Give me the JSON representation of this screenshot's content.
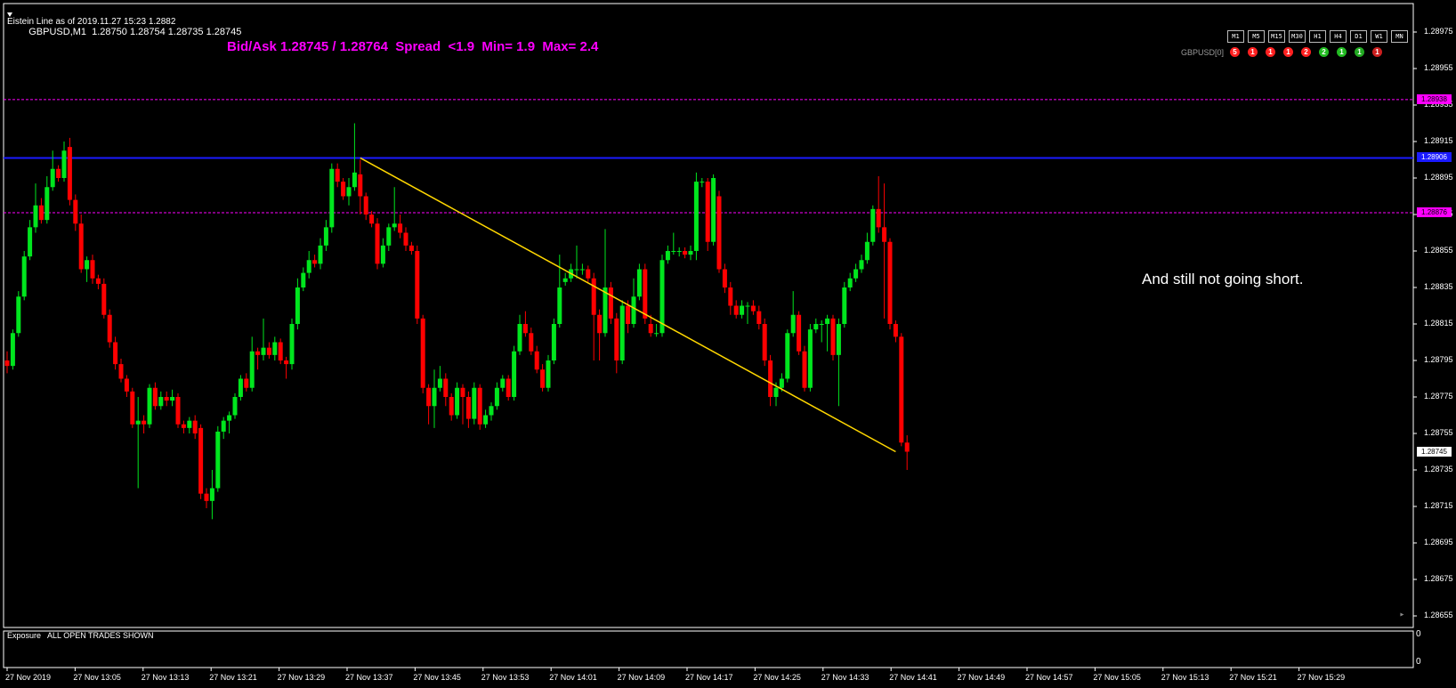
{
  "header": {
    "symbol_line": "GBPUSD,M1  1.28750 1.28754 1.28735 1.28745",
    "indicator_line": "Eistein Line as of 2019.11.27 15:23 1.2882",
    "spread_text": "Bid/Ask 1.28745 / 1.28764  Spread  <1.9  Min= 1.9  Max= 2.4"
  },
  "annotation": "And still not going short.",
  "timeframes": [
    "M1",
    "M5",
    "M15",
    "M30",
    "H1",
    "H4",
    "D1",
    "W1",
    "MN"
  ],
  "strength": {
    "label": "GBPUSD[0]",
    "dots": [
      {
        "value": "5",
        "color": "#ff2020"
      },
      {
        "value": "1",
        "color": "#ff2020"
      },
      {
        "value": "1",
        "color": "#ff2020"
      },
      {
        "value": "1",
        "color": "#ff2020"
      },
      {
        "value": "2",
        "color": "#ff2020"
      },
      {
        "value": "2",
        "color": "#22bb22"
      },
      {
        "value": "1",
        "color": "#22bb22"
      },
      {
        "value": "1",
        "color": "#22aa22"
      },
      {
        "value": "1",
        "color": "#cc1f1f"
      }
    ]
  },
  "subwindow": {
    "label": "Exposure   ALL OPEN TRADES SHOWN",
    "axis_top": "0",
    "axis_bottom": "0"
  },
  "colors": {
    "bull": "#00e61e",
    "bear": "#ff0000",
    "blue_line": "#1a1aff",
    "magenta": "#ff00ff",
    "trendline": "#ffd700"
  },
  "chart_data": {
    "type": "candlestick",
    "symbol": "GBPUSD",
    "timeframe": "M1",
    "y_ticks": [
      "1.28975",
      "1.28955",
      "1.28935",
      "1.28915",
      "1.28895",
      "1.28875",
      "1.28855",
      "1.28835",
      "1.28815",
      "1.28795",
      "1.28775",
      "1.28755",
      "1.28735",
      "1.28715",
      "1.28695",
      "1.28675",
      "1.28655"
    ],
    "ylim": [
      1.28649,
      1.28983
    ],
    "x_ticks": [
      "27 Nov 2019",
      "27 Nov 13:05",
      "27 Nov 13:13",
      "27 Nov 13:21",
      "27 Nov 13:29",
      "27 Nov 13:37",
      "27 Nov 13:45",
      "27 Nov 13:53",
      "27 Nov 14:01",
      "27 Nov 14:09",
      "27 Nov 14:17",
      "27 Nov 14:25",
      "27 Nov 14:33",
      "27 Nov 14:41",
      "27 Nov 14:49",
      "27 Nov 14:57",
      "27 Nov 15:05",
      "27 Nov 15:13",
      "27 Nov 15:21",
      "27 Nov 15:29"
    ],
    "horizontal_lines": [
      {
        "price": 1.28938,
        "label": "1.28938",
        "color": "#ff00ff",
        "style": "dashed"
      },
      {
        "price": 1.28906,
        "label": "1.28906",
        "color": "#1a1aff",
        "style": "solid"
      },
      {
        "price": 1.28876,
        "label": "1.28876",
        "color": "#ff00ff",
        "style": "dashed"
      }
    ],
    "current_price": {
      "price": 1.28745,
      "label": "1.28745"
    },
    "trendline": {
      "from": {
        "bar": 62,
        "price": 1.28906
      },
      "to": {
        "bar": 156,
        "price": 1.28745
      },
      "color": "#ffd700"
    },
    "candles": [
      [
        1.28795,
        1.28792,
        1.288,
        1.28788
      ],
      [
        1.28792,
        1.2881,
        1.28812,
        1.2879
      ],
      [
        1.2881,
        1.2883,
        1.28833,
        1.28808
      ],
      [
        1.2883,
        1.28852,
        1.28855,
        1.28828
      ],
      [
        1.28852,
        1.28868,
        1.28872,
        1.2885
      ],
      [
        1.28868,
        1.2888,
        1.28892,
        1.28865
      ],
      [
        1.2888,
        1.28872,
        1.28884,
        1.2887
      ],
      [
        1.28872,
        1.2889,
        1.28896,
        1.2887
      ],
      [
        1.2889,
        1.289,
        1.2891,
        1.28888
      ],
      [
        1.289,
        1.28895,
        1.28902,
        1.28893
      ],
      [
        1.28895,
        1.2891,
        1.28915,
        1.28893
      ],
      [
        1.28912,
        1.28883,
        1.28917,
        1.2888
      ],
      [
        1.28883,
        1.2887,
        1.28886,
        1.28866
      ],
      [
        1.2887,
        1.28845,
        1.28875,
        1.28843
      ],
      [
        1.28845,
        1.2885,
        1.28852,
        1.28838
      ],
      [
        1.2885,
        1.2884,
        1.28853,
        1.28837
      ],
      [
        1.2884,
        1.28837,
        1.28842,
        1.28834
      ],
      [
        1.28837,
        1.2882,
        1.2884,
        1.28818
      ],
      [
        1.2882,
        1.28805,
        1.28823,
        1.28802
      ],
      [
        1.28805,
        1.28793,
        1.28808,
        1.2879
      ],
      [
        1.28793,
        1.28785,
        1.28796,
        1.28783
      ],
      [
        1.28785,
        1.28778,
        1.28787,
        1.28775
      ],
      [
        1.28778,
        1.2876,
        1.2878,
        1.28758
      ],
      [
        1.2876,
        1.28762,
        1.28775,
        1.28725
      ],
      [
        1.28762,
        1.2876,
        1.28765,
        1.28755
      ],
      [
        1.2876,
        1.2878,
        1.28782,
        1.28758
      ],
      [
        1.2878,
        1.2877,
        1.28783,
        1.28768
      ],
      [
        1.2877,
        1.28775,
        1.28778,
        1.28768
      ],
      [
        1.28775,
        1.28773,
        1.28778,
        1.2877
      ],
      [
        1.28773,
        1.28775,
        1.28779,
        1.2877
      ],
      [
        1.28775,
        1.2876,
        1.28777,
        1.28758
      ],
      [
        1.2876,
        1.28758,
        1.28762,
        1.28755
      ],
      [
        1.28758,
        1.28762,
        1.28764,
        1.28755
      ],
      [
        1.28762,
        1.28755,
        1.28765,
        1.28752
      ],
      [
        1.28758,
        1.28722,
        1.2876,
        1.28719
      ],
      [
        1.28722,
        1.28718,
        1.28725,
        1.28714
      ],
      [
        1.28718,
        1.28725,
        1.28735,
        1.28708
      ],
      [
        1.28725,
        1.28756,
        1.28759,
        1.28723
      ],
      [
        1.28756,
        1.28762,
        1.28764,
        1.28752
      ],
      [
        1.28762,
        1.28765,
        1.28767,
        1.28755
      ],
      [
        1.28765,
        1.28775,
        1.28777,
        1.28763
      ],
      [
        1.28775,
        1.28785,
        1.28787,
        1.28773
      ],
      [
        1.28785,
        1.2878,
        1.28788,
        1.28778
      ],
      [
        1.2878,
        1.288,
        1.28808,
        1.28778
      ],
      [
        1.288,
        1.28798,
        1.28802,
        1.2879
      ],
      [
        1.28798,
        1.28802,
        1.28818,
        1.28795
      ],
      [
        1.28802,
        1.28798,
        1.28805,
        1.28796
      ],
      [
        1.28798,
        1.28805,
        1.28808,
        1.28795
      ],
      [
        1.28805,
        1.28795,
        1.28807,
        1.28793
      ],
      [
        1.28795,
        1.28793,
        1.28797,
        1.28785
      ],
      [
        1.28793,
        1.28815,
        1.28818,
        1.2879
      ],
      [
        1.28815,
        1.28835,
        1.2884,
        1.28812
      ],
      [
        1.28835,
        1.28843,
        1.28846,
        1.28833
      ],
      [
        1.28843,
        1.2885,
        1.28855,
        1.2884
      ],
      [
        1.2885,
        1.28848,
        1.28853,
        1.28846
      ],
      [
        1.28848,
        1.28858,
        1.28862,
        1.28845
      ],
      [
        1.28858,
        1.28868,
        1.28872,
        1.28855
      ],
      [
        1.28868,
        1.289,
        1.28903,
        1.28865
      ],
      [
        1.289,
        1.28893,
        1.28903,
        1.2889
      ],
      [
        1.28893,
        1.28885,
        1.28895,
        1.28883
      ],
      [
        1.28885,
        1.2889,
        1.28895,
        1.2888
      ],
      [
        1.2889,
        1.28898,
        1.28925,
        1.28888
      ],
      [
        1.28897,
        1.28885,
        1.28905,
        1.28875
      ],
      [
        1.28885,
        1.28875,
        1.28887,
        1.28872
      ],
      [
        1.28875,
        1.2887,
        1.28877,
        1.28868
      ],
      [
        1.2887,
        1.28848,
        1.28873,
        1.28845
      ],
      [
        1.28848,
        1.28858,
        1.28862,
        1.28846
      ],
      [
        1.28858,
        1.28868,
        1.2887,
        1.28855
      ],
      [
        1.28868,
        1.2887,
        1.2889,
        1.28866
      ],
      [
        1.2887,
        1.28865,
        1.28875,
        1.28862
      ],
      [
        1.28865,
        1.28858,
        1.28868,
        1.28855
      ],
      [
        1.28858,
        1.28855,
        1.2886,
        1.28853
      ],
      [
        1.28855,
        1.28818,
        1.28858,
        1.28815
      ],
      [
        1.28818,
        1.2878,
        1.2882,
        1.28777
      ],
      [
        1.2878,
        1.2877,
        1.28782,
        1.2876
      ],
      [
        1.2877,
        1.2878,
        1.2879,
        1.28758
      ],
      [
        1.2878,
        1.28785,
        1.28792,
        1.28778
      ],
      [
        1.28785,
        1.28775,
        1.28788,
        1.2877
      ],
      [
        1.28775,
        1.28765,
        1.28777,
        1.28762
      ],
      [
        1.28765,
        1.2878,
        1.28783,
        1.28763
      ],
      [
        1.2878,
        1.28775,
        1.28782,
        1.2876
      ],
      [
        1.28775,
        1.28763,
        1.28778,
        1.28758
      ],
      [
        1.28763,
        1.2878,
        1.28783,
        1.2876
      ],
      [
        1.2878,
        1.2876,
        1.28782,
        1.28757
      ],
      [
        1.2876,
        1.28765,
        1.28768,
        1.28758
      ],
      [
        1.28765,
        1.2877,
        1.28772,
        1.28762
      ],
      [
        1.2877,
        1.2878,
        1.28783,
        1.28768
      ],
      [
        1.2878,
        1.28785,
        1.28787,
        1.28778
      ],
      [
        1.28785,
        1.28775,
        1.28787,
        1.28773
      ],
      [
        1.28775,
        1.288,
        1.28803,
        1.28773
      ],
      [
        1.288,
        1.28815,
        1.2882,
        1.28798
      ],
      [
        1.28815,
        1.2881,
        1.28822,
        1.28808
      ],
      [
        1.2881,
        1.288,
        1.28813,
        1.28798
      ],
      [
        1.288,
        1.2879,
        1.28803,
        1.28788
      ],
      [
        1.2879,
        1.2878,
        1.28793,
        1.28778
      ],
      [
        1.2878,
        1.28795,
        1.28798,
        1.28778
      ],
      [
        1.28795,
        1.28815,
        1.28818,
        1.28793
      ],
      [
        1.28815,
        1.28835,
        1.28853,
        1.28813
      ],
      [
        1.28838,
        1.2884,
        1.28843,
        1.28836
      ],
      [
        1.2884,
        1.28845,
        1.28848,
        1.28838
      ],
      [
        1.28845,
        1.28845,
        1.28858,
        1.2884
      ],
      [
        1.28845,
        1.28845,
        1.28848,
        1.28842
      ],
      [
        1.28845,
        1.2884,
        1.28847,
        1.28838
      ],
      [
        1.2884,
        1.2882,
        1.28843,
        1.28795
      ],
      [
        1.2882,
        1.2881,
        1.28823,
        1.28795
      ],
      [
        1.2881,
        1.28835,
        1.28867,
        1.28808
      ],
      [
        1.28835,
        1.28818,
        1.28838,
        1.28815
      ],
      [
        1.28818,
        1.28795,
        1.28821,
        1.28788
      ],
      [
        1.28795,
        1.28825,
        1.28828,
        1.28793
      ],
      [
        1.28825,
        1.28815,
        1.28828,
        1.2881
      ],
      [
        1.28815,
        1.2883,
        1.2884,
        1.28813
      ],
      [
        1.2883,
        1.28845,
        1.28848,
        1.28828
      ],
      [
        1.28845,
        1.28818,
        1.28848,
        1.28815
      ],
      [
        1.28815,
        1.2881,
        1.2882,
        1.28808
      ],
      [
        1.2881,
        1.2881,
        1.28815,
        1.28808
      ],
      [
        1.2881,
        1.2885,
        1.28853,
        1.28808
      ],
      [
        1.2885,
        1.28855,
        1.28858,
        1.28848
      ],
      [
        1.28855,
        1.28855,
        1.28865,
        1.28853
      ],
      [
        1.28855,
        1.28855,
        1.28857,
        1.28852
      ],
      [
        1.28855,
        1.28853,
        1.28857,
        1.28851
      ],
      [
        1.28853,
        1.28855,
        1.28858,
        1.2885
      ],
      [
        1.28855,
        1.28893,
        1.28898,
        1.2885
      ],
      [
        1.28893,
        1.28893,
        1.28895,
        1.2889
      ],
      [
        1.28893,
        1.2886,
        1.28895,
        1.28855
      ],
      [
        1.2886,
        1.28895,
        1.28897,
        1.28858
      ],
      [
        1.28885,
        1.28845,
        1.28888,
        1.28843
      ],
      [
        1.28845,
        1.28835,
        1.28848,
        1.28832
      ],
      [
        1.28835,
        1.28825,
        1.28838,
        1.2882
      ],
      [
        1.28825,
        1.2882,
        1.28828,
        1.28818
      ],
      [
        1.2882,
        1.28825,
        1.28828,
        1.28818
      ],
      [
        1.28825,
        1.28825,
        1.28827,
        1.28815
      ],
      [
        1.28825,
        1.28822,
        1.28828,
        1.2882
      ],
      [
        1.28822,
        1.28815,
        1.28825,
        1.28812
      ],
      [
        1.28815,
        1.28795,
        1.28818,
        1.28792
      ],
      [
        1.28795,
        1.28775,
        1.28798,
        1.2877
      ],
      [
        1.28775,
        1.2878,
        1.28783,
        1.2877
      ],
      [
        1.2878,
        1.28785,
        1.28788,
        1.28778
      ],
      [
        1.28785,
        1.2881,
        1.28812,
        1.28783
      ],
      [
        1.2881,
        1.2882,
        1.28833,
        1.28808
      ],
      [
        1.2882,
        1.288,
        1.28822,
        1.28798
      ],
      [
        1.288,
        1.2878,
        1.28803,
        1.28778
      ],
      [
        1.2878,
        1.28812,
        1.28815,
        1.28778
      ],
      [
        1.28812,
        1.28815,
        1.28818,
        1.2881
      ],
      [
        1.28815,
        1.28815,
        1.28817,
        1.28805
      ],
      [
        1.28815,
        1.28818,
        1.2882,
        1.288
      ],
      [
        1.28818,
        1.28798,
        1.2882,
        1.28795
      ],
      [
        1.28798,
        1.28815,
        1.28818,
        1.2877
      ],
      [
        1.28815,
        1.28835,
        1.28838,
        1.28813
      ],
      [
        1.28835,
        1.2884,
        1.28843,
        1.28833
      ],
      [
        1.2884,
        1.28845,
        1.28848,
        1.28838
      ],
      [
        1.28845,
        1.2885,
        1.28853,
        1.28843
      ],
      [
        1.2885,
        1.2886,
        1.28865,
        1.28848
      ],
      [
        1.2886,
        1.28878,
        1.2888,
        1.28858
      ],
      [
        1.28878,
        1.28868,
        1.28896,
        1.28865
      ],
      [
        1.28868,
        1.2886,
        1.28892,
        1.28818
      ],
      [
        1.2886,
        1.28815,
        1.28862,
        1.28812
      ],
      [
        1.28815,
        1.28808,
        1.28817,
        1.28805
      ],
      [
        1.28808,
        1.2875,
        1.2881,
        1.28748
      ],
      [
        1.2875,
        1.28745,
        1.28754,
        1.28735
      ]
    ]
  }
}
